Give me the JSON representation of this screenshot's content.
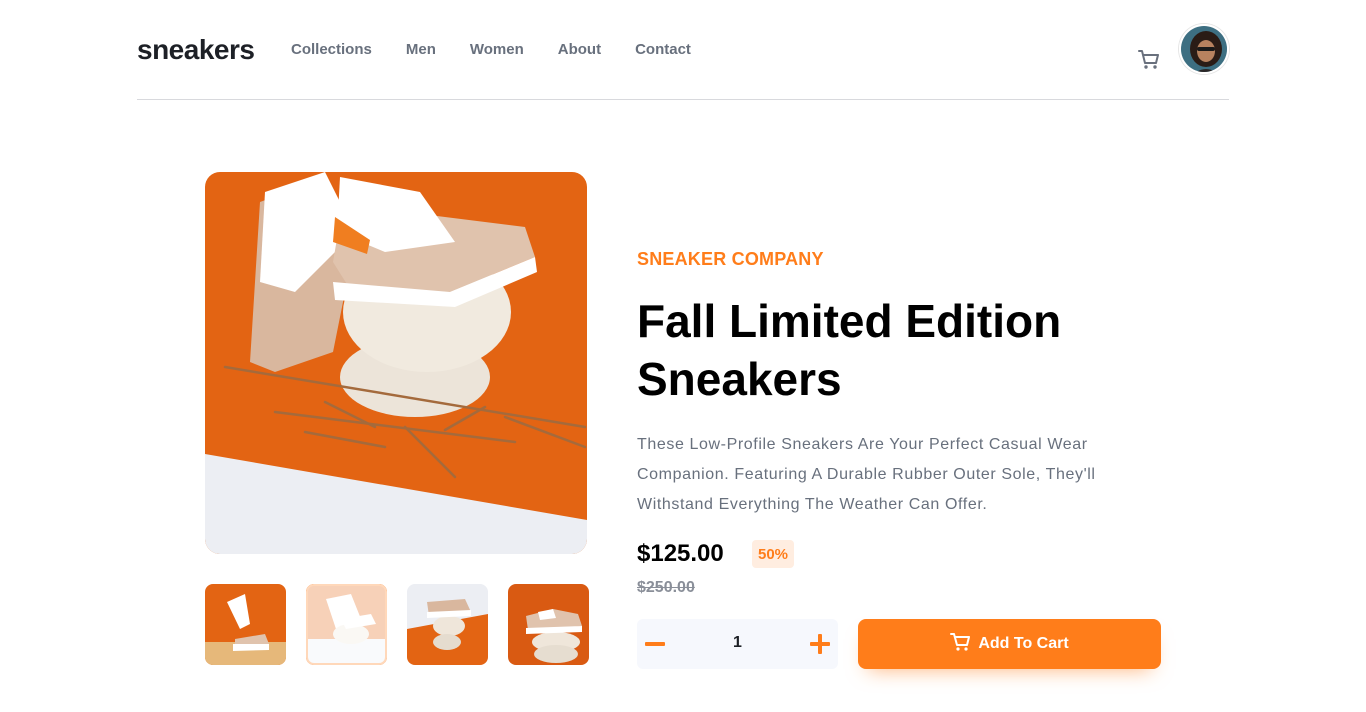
{
  "header": {
    "logo": "sneakers",
    "nav": [
      "Collections",
      "Men",
      "Women",
      "About",
      "Contact"
    ],
    "cart_icon": "cart-icon",
    "avatar_icon": "user-avatar"
  },
  "gallery": {
    "thumbnail_count": 4,
    "active_thumbnail": 2
  },
  "product": {
    "company": "SNEAKER COMPANY",
    "title": "Fall Limited Edition Sneakers",
    "description": "These Low-Profile Sneakers Are Your Perfect Casual Wear Companion. Featuring A Durable Rubber Outer Sole, They'll Withstand Everything The Weather Can Offer.",
    "price": "$125.00",
    "discount": "50%",
    "old_price": "$250.00"
  },
  "cart": {
    "quantity": "1",
    "add_label": "Add To Cart"
  },
  "colors": {
    "accent": "#ff7d1a",
    "accent_pale": "#ffede0",
    "text_dark": "#1d2026",
    "text_grey": "#68707d",
    "qty_bg": "#f6f8fd"
  }
}
